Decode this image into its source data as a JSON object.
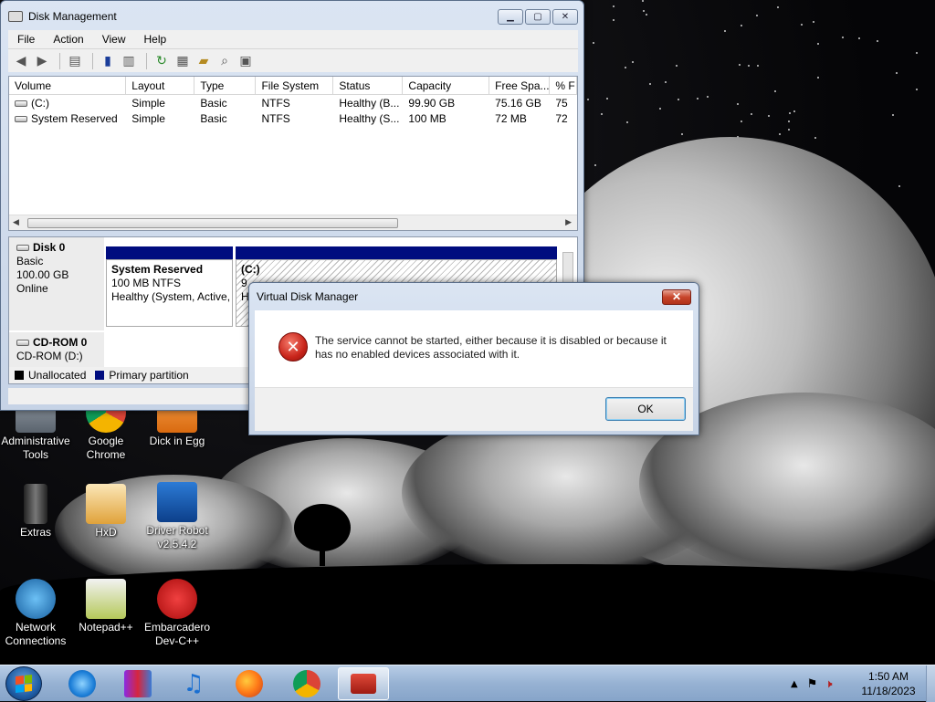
{
  "desktop": {
    "icons": [
      {
        "name": "administrative-tools-shortcut",
        "label": "Administrative\nTools"
      },
      {
        "name": "google-chrome-shortcut",
        "label": "Google\nChrome"
      },
      {
        "name": "dick-in-egg-shortcut",
        "label": "Dick in Egg"
      },
      {
        "name": "extras-shortcut",
        "label": "Extras"
      },
      {
        "name": "hxd-shortcut",
        "label": "HxD"
      },
      {
        "name": "driver-robot-shortcut",
        "label": "Driver Robot\nv2.5.4.2"
      },
      {
        "name": "network-connections-shortcut",
        "label": "Network\nConnections"
      },
      {
        "name": "notepad-plus-plus-shortcut",
        "label": "Notepad++"
      },
      {
        "name": "embarcadero-devcpp-shortcut",
        "label": "Embarcadero\nDev-C++"
      }
    ]
  },
  "disk_management": {
    "title": "Disk Management",
    "menu": [
      "File",
      "Action",
      "View",
      "Help"
    ],
    "columns": [
      "Volume",
      "Layout",
      "Type",
      "File System",
      "Status",
      "Capacity",
      "Free Spa...",
      "% F"
    ],
    "rows": [
      [
        "(C:)",
        "Simple",
        "Basic",
        "NTFS",
        "Healthy (B...",
        "99.90 GB",
        "75.16 GB",
        "75"
      ],
      [
        "System Reserved",
        "Simple",
        "Basic",
        "NTFS",
        "Healthy (S...",
        "100 MB",
        "72 MB",
        "72"
      ]
    ],
    "disks": {
      "disk0": {
        "name": "Disk 0",
        "type": "Basic",
        "size": "100.00 GB",
        "state": "Online"
      },
      "cdrom0": {
        "name": "CD-ROM 0",
        "drive": "CD-ROM (D:)"
      }
    },
    "partitions": {
      "system_reserved": {
        "name": "System Reserved",
        "size": "100 MB NTFS",
        "status": "Healthy (System, Active,"
      },
      "c": {
        "name": "(C:)",
        "size": "9",
        "status": "H"
      }
    },
    "legend": {
      "unallocated": "Unallocated",
      "primary": "Primary partition"
    },
    "colors": {
      "unallocated": "#000000",
      "primary": "#000c7f"
    }
  },
  "dialog": {
    "title": "Virtual Disk Manager",
    "message": "The service cannot be started, either because it is disabled or because it has no enabled devices associated with it.",
    "ok_label": "OK",
    "close_glyph": "✕",
    "icon": "error-icon"
  },
  "taskbar": {
    "apps": [
      "internet-explorer",
      "winrar",
      "itunes",
      "firefox",
      "chrome",
      "toolbox"
    ],
    "time": "1:50 AM",
    "date": "11/18/2023"
  }
}
